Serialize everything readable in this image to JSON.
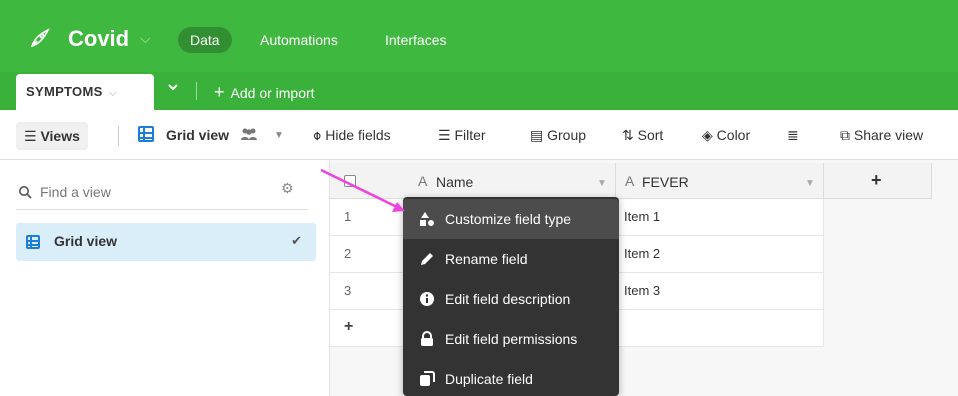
{
  "app": {
    "title": "Covid",
    "brand_color": "#3fb83f",
    "nav": [
      {
        "label": "Data",
        "active": true
      },
      {
        "label": "Automations",
        "active": false
      },
      {
        "label": "Interfaces",
        "active": false
      }
    ]
  },
  "tabs": {
    "active_table": "SYMPTOMS",
    "add_label": "Add or import"
  },
  "toolbar": {
    "views_label": "Views",
    "current_view": "Grid view",
    "hide_fields": "Hide fields",
    "filter": "Filter",
    "group": "Group",
    "sort": "Sort",
    "color": "Color",
    "share_view": "Share view"
  },
  "sidebar": {
    "search_placeholder": "Find a view",
    "items": [
      {
        "label": "Grid view",
        "selected": true
      }
    ]
  },
  "grid": {
    "columns": [
      {
        "label": "Name",
        "icon": "text-field-icon"
      },
      {
        "label": "FEVER",
        "icon": "text-field-icon"
      }
    ],
    "add_column_label": "+",
    "rows": [
      {
        "num": "1",
        "fever": "Item 1"
      },
      {
        "num": "2",
        "fever": "Item 2"
      },
      {
        "num": "3",
        "fever": "Item 3"
      }
    ],
    "add_row_label": "+"
  },
  "context_menu": {
    "items": [
      {
        "label": "Customize field type",
        "icon": "shapes-icon",
        "highlighted": true
      },
      {
        "label": "Rename field",
        "icon": "pencil-icon",
        "highlighted": false
      },
      {
        "label": "Edit field description",
        "icon": "info-icon",
        "highlighted": false
      },
      {
        "label": "Edit field permissions",
        "icon": "lock-icon",
        "highlighted": false
      },
      {
        "label": "Duplicate field",
        "icon": "duplicate-icon",
        "highlighted": false
      }
    ]
  },
  "annotation": {
    "arrow_color": "#ee44dd"
  }
}
